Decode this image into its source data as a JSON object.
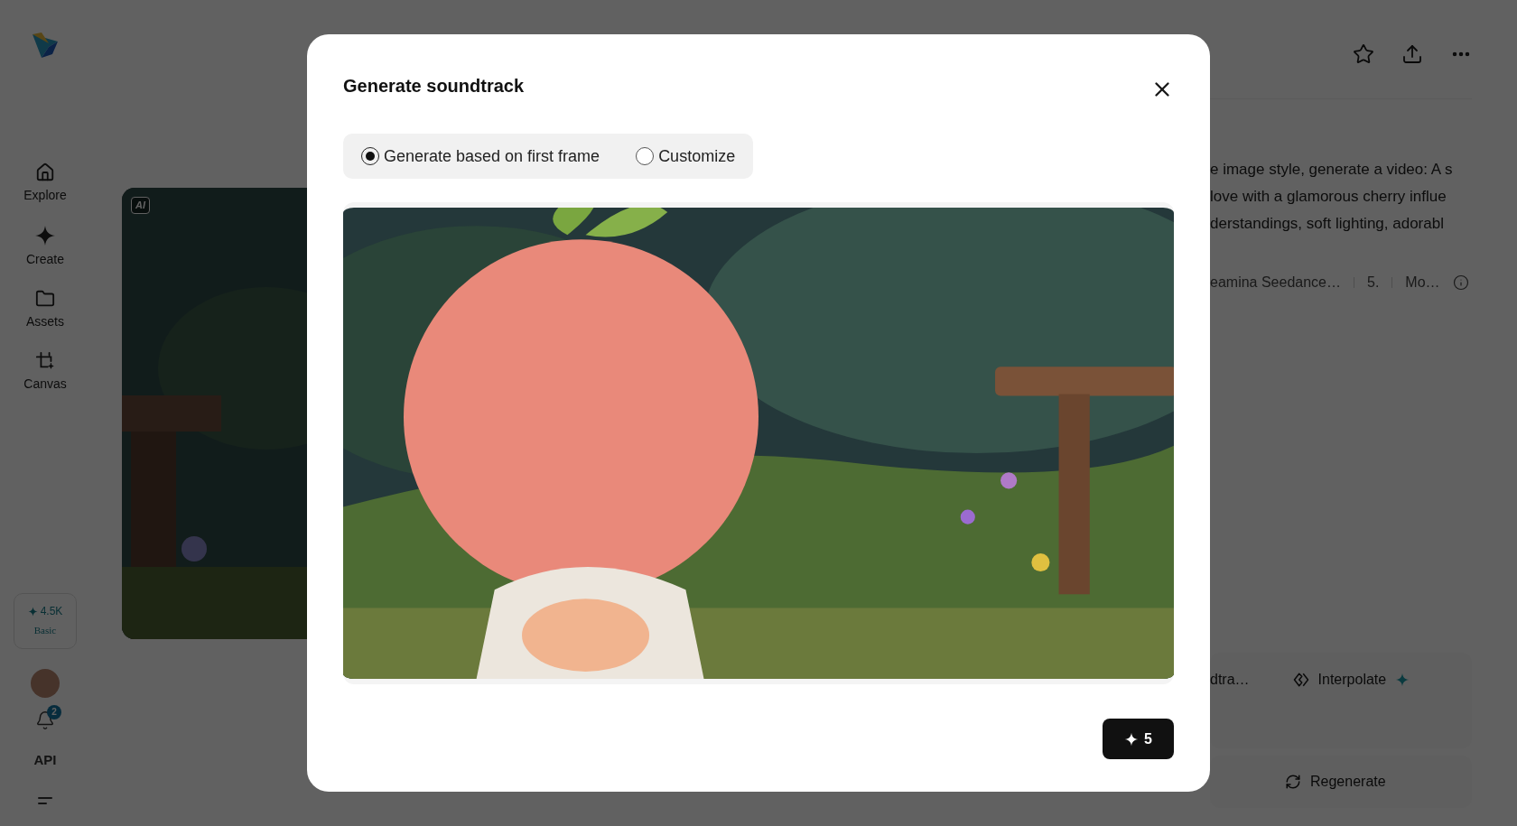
{
  "sidebar": {
    "nav": [
      {
        "label": "Explore",
        "kind": "home"
      },
      {
        "label": "Create",
        "kind": "create"
      },
      {
        "label": "Assets",
        "kind": "folder"
      },
      {
        "label": "Canvas",
        "kind": "canvas"
      }
    ],
    "credits": {
      "amount": "4.5K",
      "plan": "Basic"
    },
    "notifications": {
      "count": "2"
    },
    "api_label": "API"
  },
  "preview": {
    "badge": "AI"
  },
  "details": {
    "prompt_lines": [
      "e image style, generate a video: A s",
      "love with a glamorous cherry influe",
      "derstandings, soft lighting, adorabl"
    ],
    "meta": [
      "eamina Seedance…",
      "5.",
      "Mo…"
    ],
    "actions": [
      {
        "label": "dtra…",
        "kind": "plain"
      },
      {
        "label": "Interpolate",
        "kind": "interpolate"
      }
    ],
    "regenerate": "Regenerate"
  },
  "modal": {
    "title": "Generate soundtrack",
    "options": [
      {
        "label": "Generate based on first frame",
        "selected": true
      },
      {
        "label": "Customize",
        "selected": false
      }
    ],
    "submit": {
      "cost": "5"
    }
  }
}
